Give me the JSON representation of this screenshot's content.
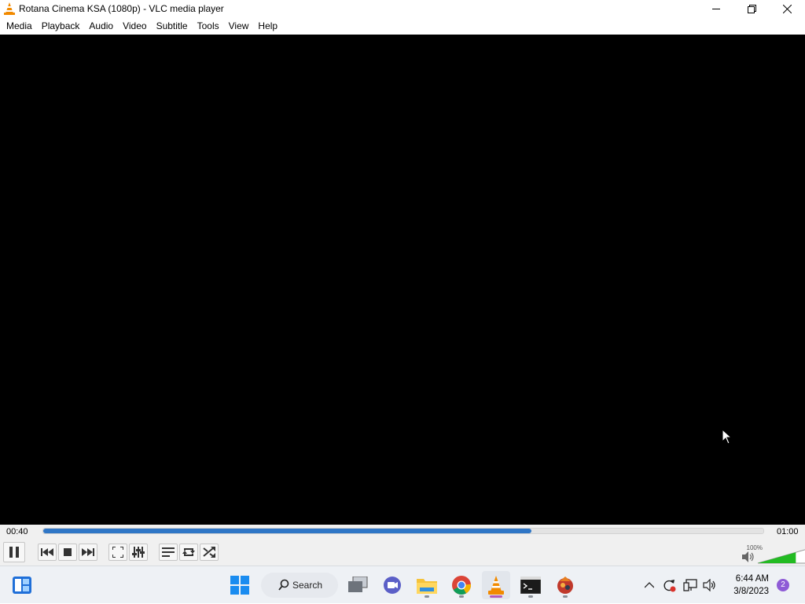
{
  "window": {
    "title": "Rotana Cinema KSA (1080p) - VLC media player",
    "controls": [
      "minimize",
      "restore",
      "close"
    ]
  },
  "menu": [
    "Media",
    "Playback",
    "Audio",
    "Video",
    "Subtitle",
    "Tools",
    "View",
    "Help"
  ],
  "player": {
    "elapsed": "00:40",
    "total": "01:00",
    "progress_fraction": 0.678,
    "volume_label": "100%",
    "volume_fraction": 0.69,
    "accent": "#2f76c6",
    "volume_color": "#22bb22"
  },
  "taskbar": {
    "search_label": "Search",
    "clock_time": "6:44 AM",
    "clock_date": "3/8/2023",
    "notification_count": "2"
  }
}
